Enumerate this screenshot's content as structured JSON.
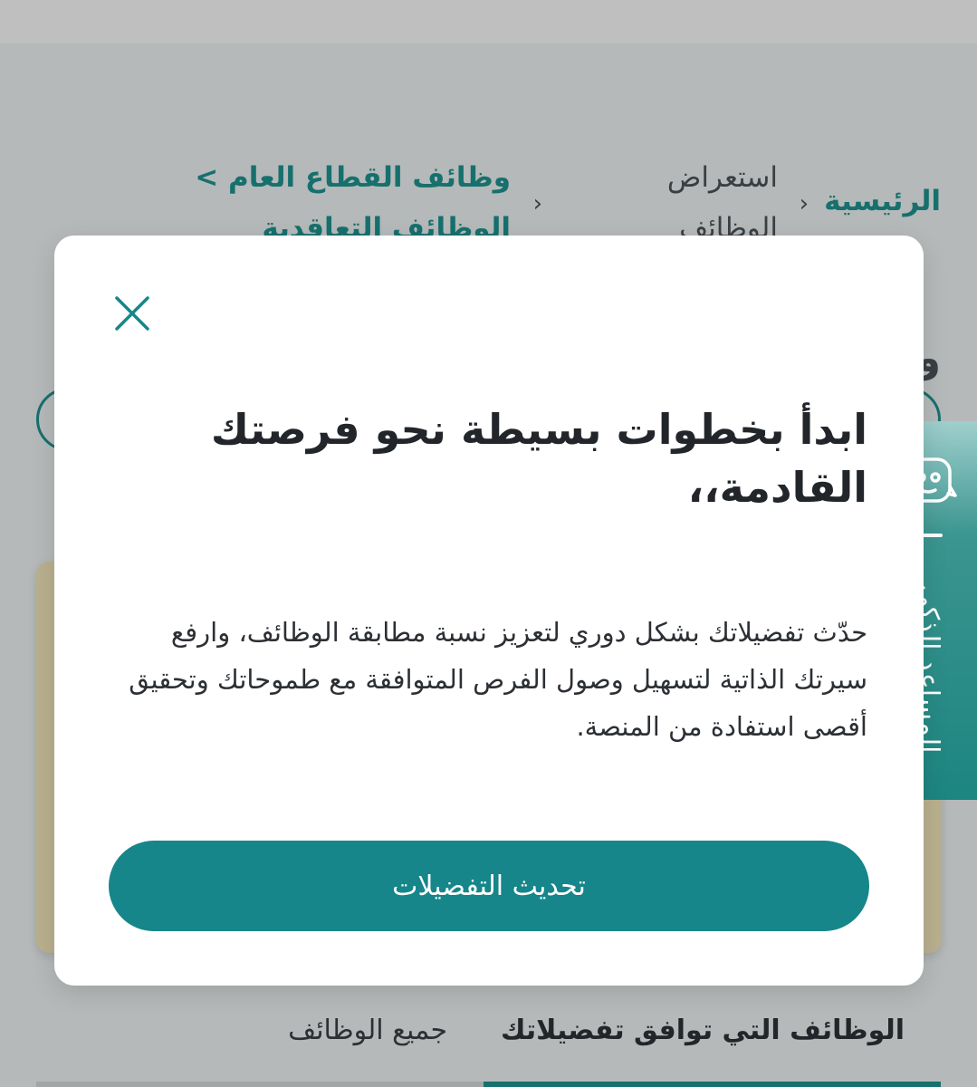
{
  "breadcrumb": {
    "home": "الرئيسية",
    "browse": "استعراض الوظائف",
    "sector": "وظائف القطاع العام > الوظائف التعاقدية",
    "separator": "‹"
  },
  "background": {
    "title_fragment": "و"
  },
  "tabs": {
    "matching": "الوظائف التي توافق تفضيلاتك",
    "all": "جميع الوظائف"
  },
  "assistant": {
    "label": "المساعد الذكي",
    "icon": "robot-chat-icon"
  },
  "modal": {
    "close_icon": "close-icon",
    "title": "ابدأ بخطوات بسيطة نحو فرصتك القادمة،،",
    "description": "حدّث تفضيلاتك بشكل دوري لتعزيز نسبة مطابقة الوظائف، وارفع سيرتك الذاتية لتسهيل وصول الفرص المتوافقة مع طموحاتك وتحقيق أقصى استفادة من المنصة.",
    "button": "تحديث التفضيلات"
  },
  "colors": {
    "accent": "#16868a",
    "text_dark": "#22262a",
    "overlay_bg": "#b5b9b9"
  }
}
